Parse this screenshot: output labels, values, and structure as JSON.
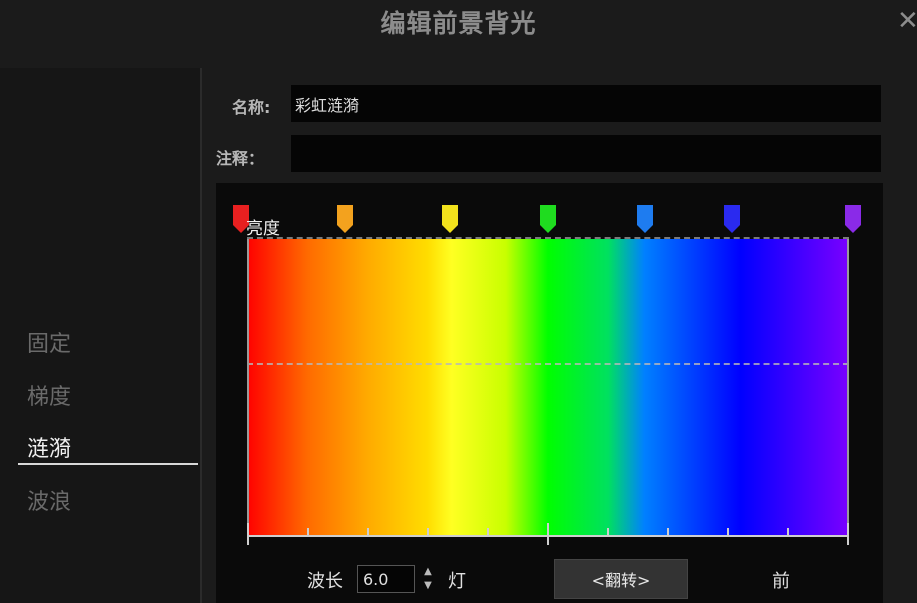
{
  "dialog": {
    "title": "编辑前景背光",
    "close_icon": "close-icon"
  },
  "sidebar": {
    "items": [
      {
        "label": "固定",
        "active": false
      },
      {
        "label": "梯度",
        "active": false
      },
      {
        "label": "涟漪",
        "active": true
      },
      {
        "label": "波浪",
        "active": false
      }
    ]
  },
  "form": {
    "name_label": "名称:",
    "name_value": "彩虹涟漪",
    "comment_label": "注释：",
    "comment_value": ""
  },
  "editor": {
    "brightness_label": "亮度",
    "stops": [
      {
        "color": "#e82020"
      },
      {
        "color": "#f3a21e"
      },
      {
        "color": "#f2e21c"
      },
      {
        "color": "#1fdc1f"
      },
      {
        "color": "#1e7cf0"
      },
      {
        "color": "#2a2af0"
      },
      {
        "color": "#8a2ae8"
      }
    ],
    "gradient_colors": [
      "#ff0000",
      "#ff6a00",
      "#ffdd00",
      "#00ff00",
      "#0080ff",
      "#0000ff",
      "#7a00ff"
    ]
  },
  "controls": {
    "wavelength_label": "波长",
    "wavelength_value": "6.0",
    "spinner_icon": "up-down-arrows-icon",
    "lamp_label": "灯",
    "flip_label": "<翻转>",
    "direction_label": "前"
  }
}
